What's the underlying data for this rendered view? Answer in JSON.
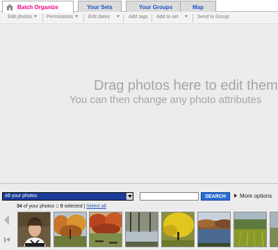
{
  "tabs": [
    {
      "label": "Batch Organize",
      "active": true
    },
    {
      "label": "Your Sets",
      "active": false
    },
    {
      "label": "Your Groups",
      "active": false
    },
    {
      "label": "Map",
      "active": false
    }
  ],
  "toolbar": {
    "edit_photos": "Edit photos",
    "permissions": "Permissions",
    "edit_dates": "Edit dates",
    "add_tags": "Add tags",
    "add_to_set": "Add to set",
    "send_to_group": "Send to Group"
  },
  "drop_area": {
    "line1": "Drag photos here to edit them",
    "line2": "You can then change any photo attributes"
  },
  "filter": {
    "selected": "All your photos"
  },
  "search": {
    "value": "",
    "button_label": "SEARCH"
  },
  "more_options": "More options",
  "status": {
    "count": "34",
    "of_your_photos": "of your photos",
    "separator": "::",
    "selected_count": "0",
    "selected_text": "selected |",
    "select_all": "Select all"
  },
  "thumbnails": [
    {
      "subject": "portrait of boy"
    },
    {
      "subject": "autumn trees"
    },
    {
      "subject": "park with benches"
    },
    {
      "subject": "wooded pond"
    },
    {
      "subject": "yellow tree"
    },
    {
      "subject": "autumn lake"
    },
    {
      "subject": "grass and trees"
    },
    {
      "subject": "partial photo"
    }
  ],
  "colors": {
    "brand_pink": "#ff0084",
    "link_blue": "#1a57c5",
    "select_bg": "#1b3c98",
    "search_button": "#2a6fd6"
  }
}
